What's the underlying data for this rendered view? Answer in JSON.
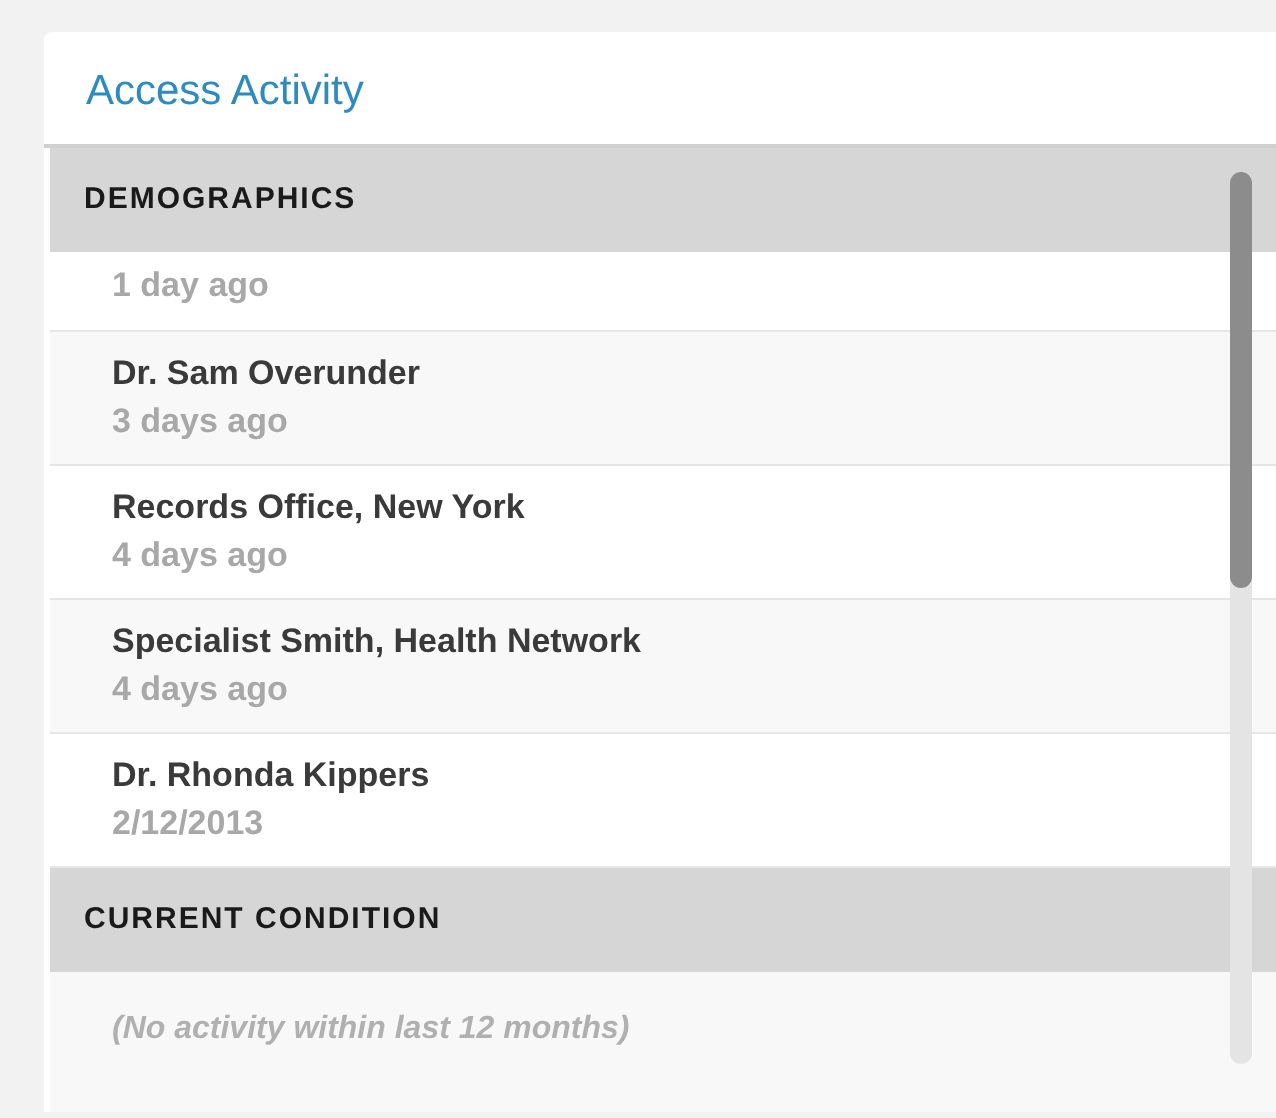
{
  "panel": {
    "title": "Access Activity"
  },
  "sections": [
    {
      "heading": "DEMOGRAPHICS",
      "entries": [
        {
          "when": "1 day ago"
        },
        {
          "name": "Dr. Sam Overunder",
          "when": "3 days ago"
        },
        {
          "name": "Records Office, New York",
          "when": "4 days ago"
        },
        {
          "name": "Specialist Smith, Health Network",
          "when": "4 days ago"
        },
        {
          "name": "Dr. Rhonda Kippers",
          "when": "2/12/2013"
        }
      ]
    },
    {
      "heading": "CURRENT CONDITION",
      "empty_message": "(No activity within last 12 months)"
    }
  ]
}
